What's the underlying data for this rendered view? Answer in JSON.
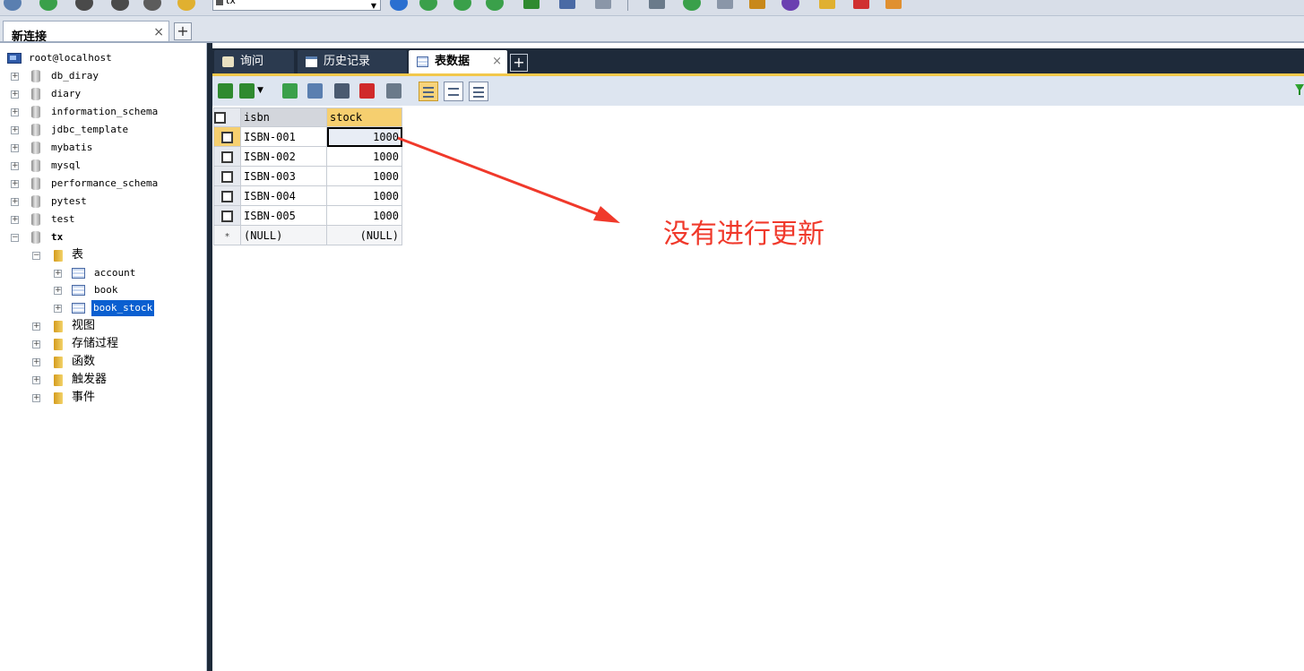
{
  "connection_tab": {
    "label": "新连接",
    "close": "×",
    "add": "+"
  },
  "toolbar": {
    "database_select": "tx"
  },
  "tree": {
    "host": "root@localhost",
    "databases": [
      {
        "name": "db_diray",
        "expander": "+"
      },
      {
        "name": "diary",
        "expander": "+"
      },
      {
        "name": "information_schema",
        "expander": "+"
      },
      {
        "name": "jdbc_template",
        "expander": "+"
      },
      {
        "name": "mybatis",
        "expander": "+"
      },
      {
        "name": "mysql",
        "expander": "+"
      },
      {
        "name": "performance_schema",
        "expander": "+"
      },
      {
        "name": "pytest",
        "expander": "+"
      },
      {
        "name": "test",
        "expander": "+"
      },
      {
        "name": "tx",
        "expander": "−"
      }
    ],
    "tables_folder": "表",
    "tables": [
      "account",
      "book",
      "book_stock"
    ],
    "folders": [
      "视图",
      "存储过程",
      "函数",
      "触发器",
      "事件"
    ]
  },
  "subtabs": {
    "query": "询问",
    "history": "历史记录",
    "table_data": "表数据",
    "close": "×",
    "add": "+"
  },
  "grid": {
    "columns": [
      "isbn",
      "stock"
    ],
    "rows": [
      {
        "isbn": "ISBN-001",
        "stock": "1000"
      },
      {
        "isbn": "ISBN-002",
        "stock": "1000"
      },
      {
        "isbn": "ISBN-003",
        "stock": "1000"
      },
      {
        "isbn": "ISBN-004",
        "stock": "1000"
      },
      {
        "isbn": "ISBN-005",
        "stock": "1000"
      }
    ],
    "new_row": {
      "marker": "*",
      "isbn": "(NULL)",
      "stock": "(NULL)"
    }
  },
  "annotation": {
    "text": "没有进行更新",
    "color": "#f0392b"
  }
}
